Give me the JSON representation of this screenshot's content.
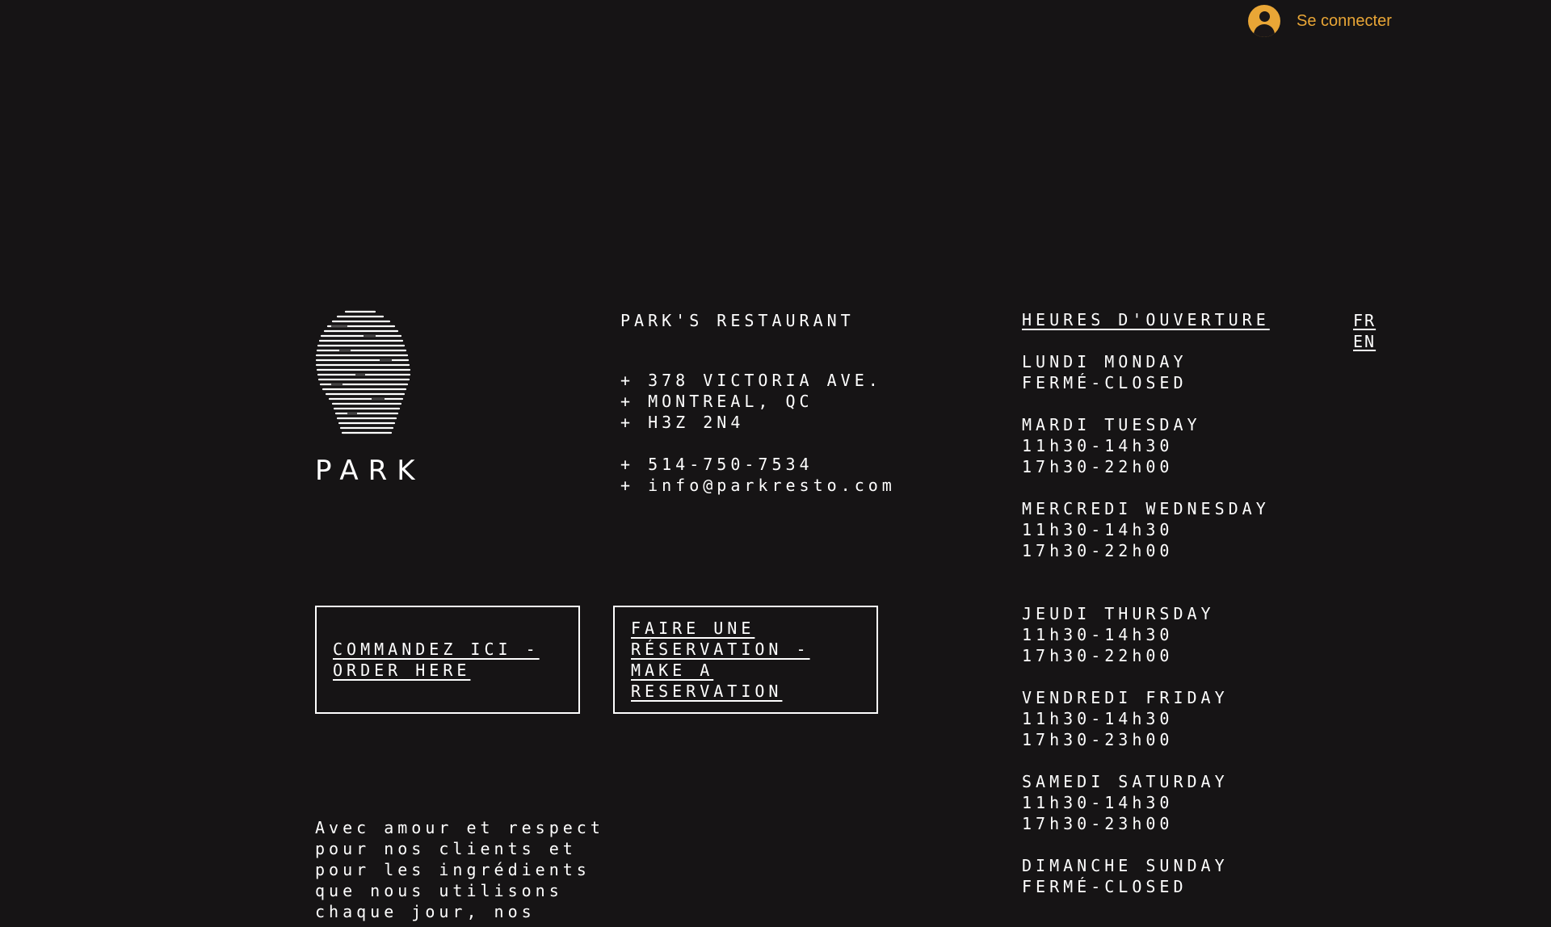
{
  "header": {
    "login_label": "Se connecter",
    "accent_color": "#e9a636"
  },
  "logo": {
    "icon": "striped-head-logo",
    "wordmark": "PARK"
  },
  "info": {
    "name": "PARK'S RESTAURANT",
    "address": [
      "+ 378 VICTORIA AVE.",
      "+ MONTREAL, QC",
      "+ H3Z 2N4"
    ],
    "contact": [
      "+ 514-750-7534",
      "+ info@parkresto.com"
    ]
  },
  "buttons": {
    "order": "COMMANDEZ ICI - ORDER HERE",
    "reserve": "FAIRE UNE RÉSERVATION - MAKE A RESERVATION"
  },
  "hours": {
    "title": "HEURES D'OUVERTURE",
    "days": [
      {
        "day": "LUNDI MONDAY",
        "lines": [
          "FERMÉ-CLOSED"
        ]
      },
      {
        "day": "MARDI TUESDAY",
        "lines": [
          "11h30-14h30",
          "17h30-22h00"
        ]
      },
      {
        "day": "MERCREDI WEDNESDAY",
        "lines": [
          "11h30-14h30",
          "17h30-22h00"
        ]
      },
      {
        "day": "JEUDI THURSDAY",
        "lines": [
          "11h30-14h30",
          "17h30-22h00"
        ]
      },
      {
        "day": "VENDREDI FRIDAY",
        "lines": [
          "11h30-14h30",
          "17h30-23h00"
        ]
      },
      {
        "day": "SAMEDI SATURDAY",
        "lines": [
          "11h30-14h30",
          "17h30-23h00"
        ]
      },
      {
        "day": "DIMANCHE SUNDAY",
        "lines": [
          "FERMÉ-CLOSED"
        ]
      }
    ]
  },
  "language": {
    "fr": "FR",
    "en": "EN"
  },
  "tagline": {
    "lines": [
      "Avec amour et respect",
      "pour nos clients et",
      "pour les ingrédients",
      "que nous utilisons",
      "chaque jour, nos"
    ]
  }
}
